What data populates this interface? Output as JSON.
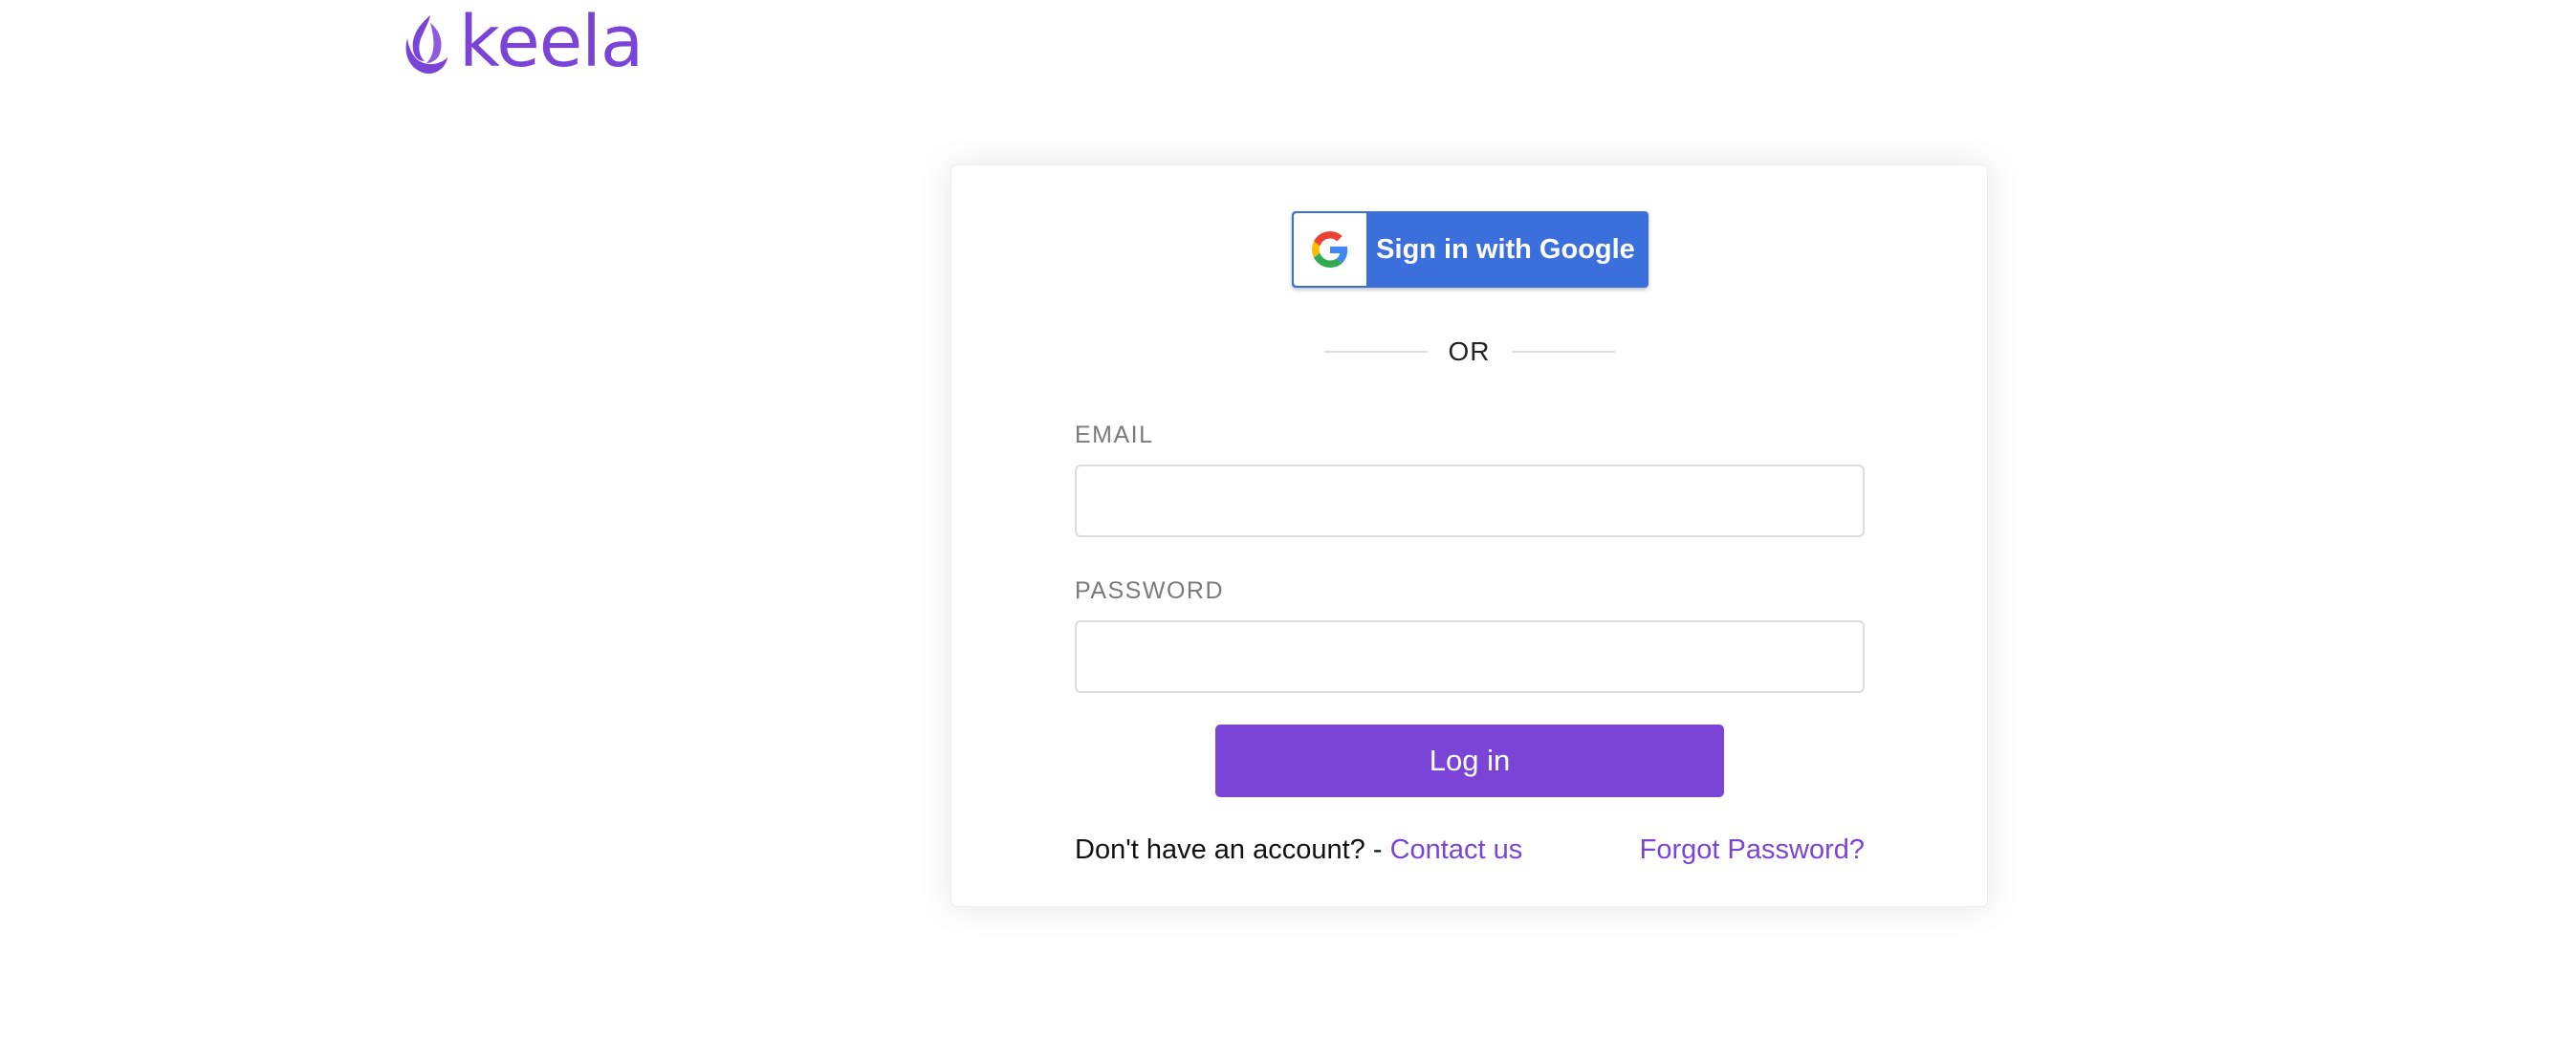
{
  "brand": {
    "name": "keela",
    "logo_icon": "keela-leaf-icon"
  },
  "colors": {
    "brand_purple": "#7a45d6",
    "google_blue": "#3b6fdb",
    "link_purple": "#7a45d6",
    "login_button": "#7a45d6"
  },
  "google_sign_in": {
    "label": "Sign in with Google",
    "icon": "google-g-icon"
  },
  "divider": {
    "text": "OR"
  },
  "form": {
    "email": {
      "label": "EMAIL",
      "value": "",
      "placeholder": ""
    },
    "password": {
      "label": "PASSWORD",
      "value": "",
      "placeholder": ""
    },
    "submit_label": "Log in"
  },
  "footer": {
    "no_account_text": "Don't have an account? - ",
    "contact_link": "Contact us",
    "forgot_link": "Forgot Password?"
  }
}
